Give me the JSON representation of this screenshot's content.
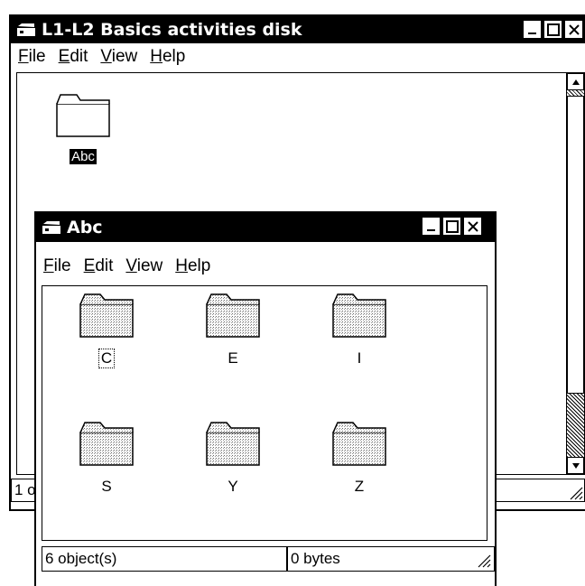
{
  "outer": {
    "title": "L1-L2 Basics activities disk",
    "menu": [
      "File",
      "Edit",
      "View",
      "Help"
    ],
    "folder_label": "Abc",
    "status_left": "1 o"
  },
  "inner": {
    "title": "Abc",
    "menu": [
      "File",
      "Edit",
      "View",
      "Help"
    ],
    "folders": [
      "C",
      "E",
      "I",
      "S",
      "Y",
      "Z"
    ],
    "status_objects": "6 object(s)",
    "status_size": "0 bytes"
  },
  "icons": {
    "window_icon": "drive-icon",
    "minimize": "minimize-icon",
    "maximize": "maximize-icon",
    "close": "close-icon",
    "folder": "folder-icon"
  }
}
